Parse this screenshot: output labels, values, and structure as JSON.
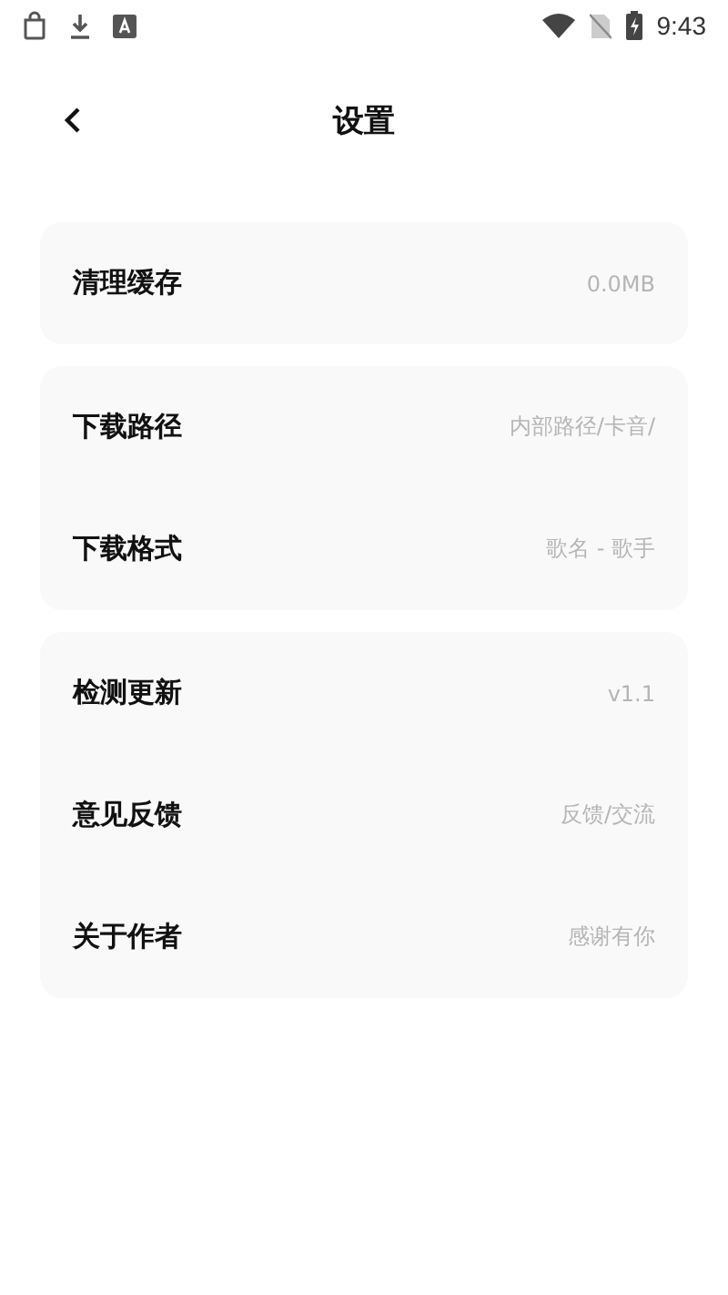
{
  "status_bar": {
    "time": "9:43"
  },
  "header": {
    "title": "设置"
  },
  "groups": [
    {
      "items": [
        {
          "label": "清理缓存",
          "value": "0.0MB"
        }
      ]
    },
    {
      "items": [
        {
          "label": "下载路径",
          "value": "内部路径/卡音/"
        },
        {
          "label": "下载格式",
          "value": "歌名 - 歌手"
        }
      ]
    },
    {
      "items": [
        {
          "label": "检测更新",
          "value": "v1.1"
        },
        {
          "label": "意见反馈",
          "value": "反馈/交流"
        },
        {
          "label": "关于作者",
          "value": "感谢有你"
        }
      ]
    }
  ]
}
